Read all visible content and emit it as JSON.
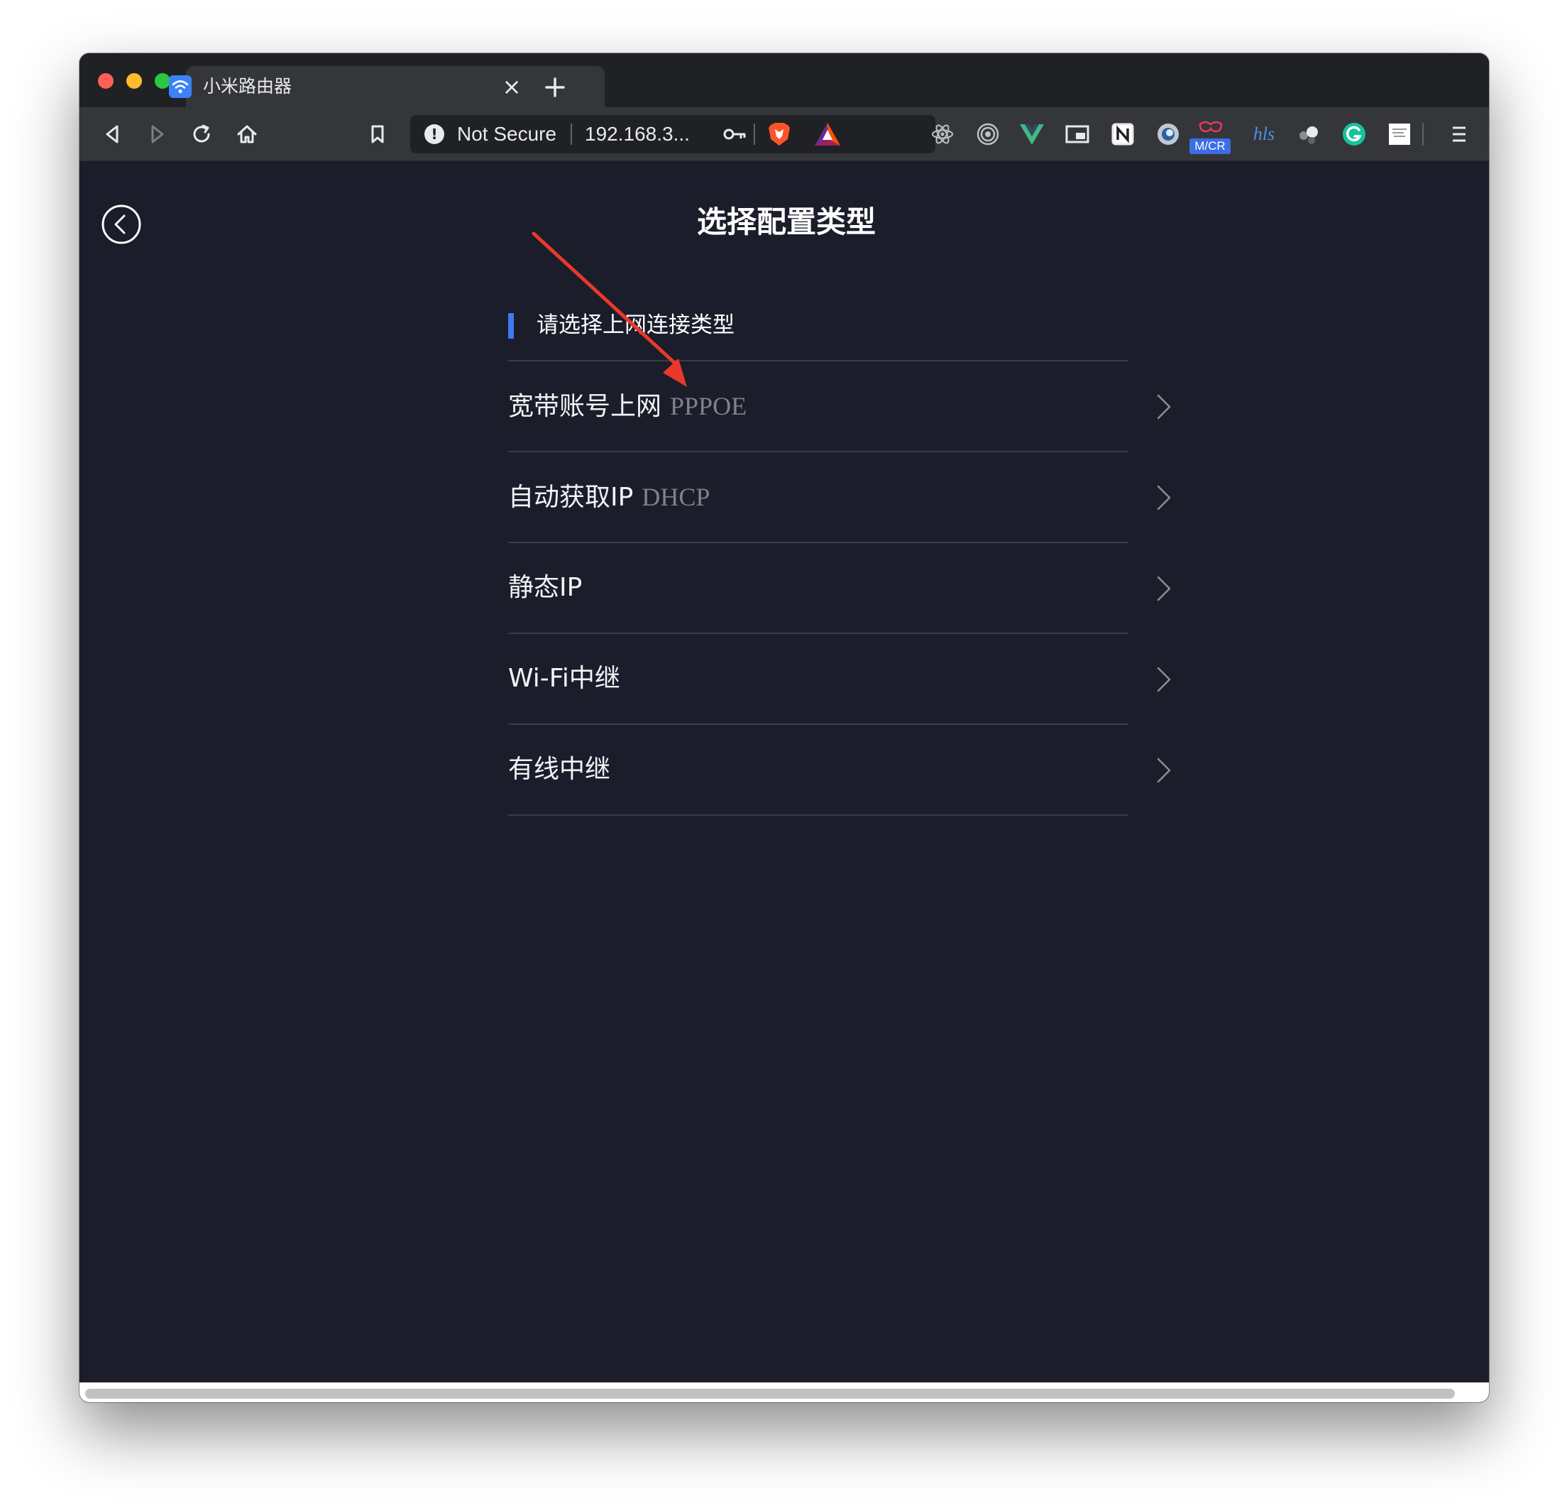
{
  "browser": {
    "tab": {
      "title": "小米路由器",
      "close_glyph": "×",
      "favicon": "wifi-icon"
    },
    "omnibox": {
      "security_label": "Not Secure",
      "warning_glyph": "!",
      "url": "192.168.3..."
    },
    "extensions": {
      "mcr_label": "M/CR",
      "hls_label": "hls"
    },
    "colors": {
      "chrome_dark": "#202124",
      "toolbar": "#35363a",
      "accent_blue": "#3f7bf0"
    }
  },
  "page": {
    "title": "选择配置类型",
    "section_label": "请选择上网连接类型",
    "options": [
      {
        "label": "宽带账号上网",
        "sub": "PPPOE"
      },
      {
        "label": "自动获取IP",
        "sub": "DHCP"
      },
      {
        "label": "静态IP",
        "sub": ""
      },
      {
        "label": "Wi-Fi中继",
        "sub": ""
      },
      {
        "label": "有线中继",
        "sub": ""
      }
    ],
    "colors": {
      "background": "#1b1d2b",
      "divider": "#3a3c49",
      "annotation": "#e8392b"
    }
  }
}
